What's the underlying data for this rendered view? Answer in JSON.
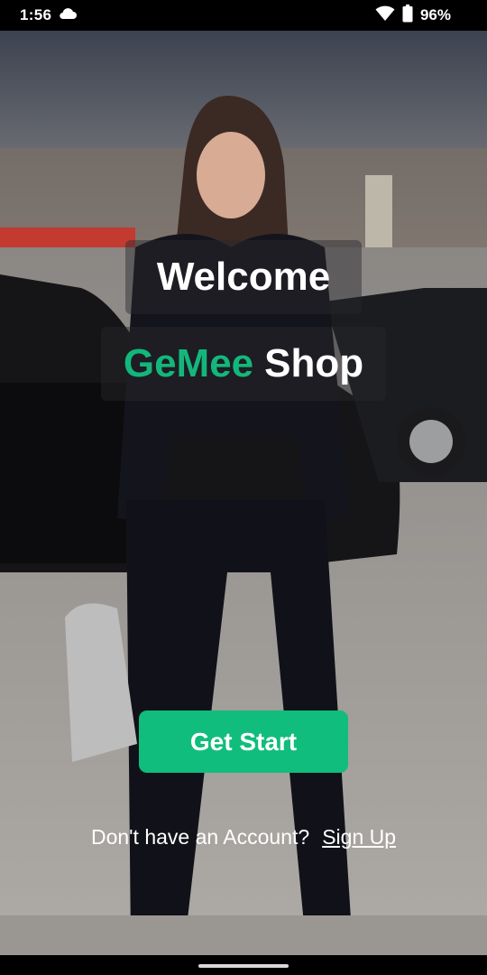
{
  "status_bar": {
    "time": "1:56",
    "battery": "96%",
    "icons": [
      "cloud-icon",
      "wifi-icon",
      "battery-icon"
    ]
  },
  "hero": {
    "welcome": "Welcome",
    "brand_accent": "GeMee",
    "brand_rest": "Shop"
  },
  "cta": {
    "get_start_label": "Get Start"
  },
  "signup": {
    "prompt": "Don't have an Account?",
    "link_label": "Sign Up"
  },
  "colors": {
    "accent": "#10bd7c",
    "brand_text": "#14b77b",
    "overlay": "rgba(40,40,44,0.45)"
  }
}
